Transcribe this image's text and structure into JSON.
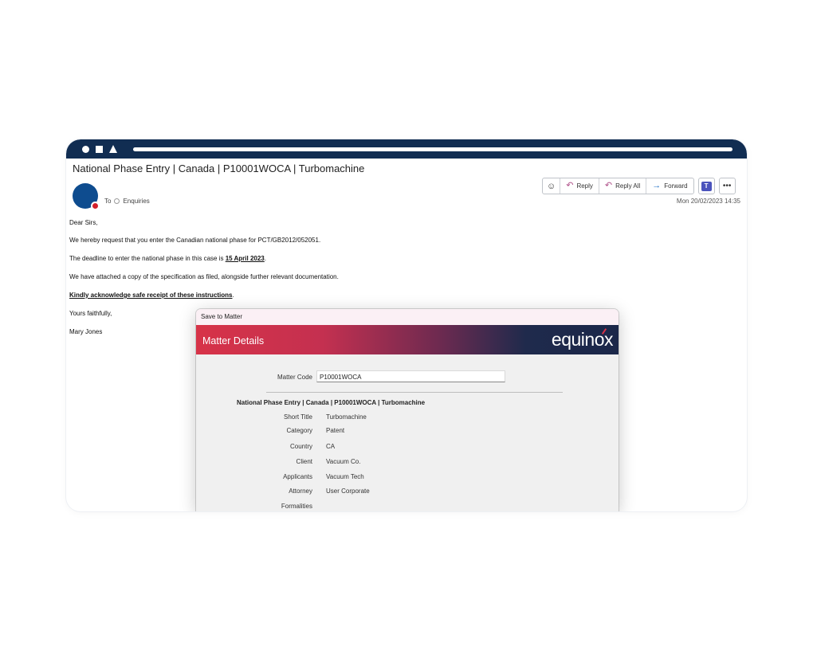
{
  "window": {
    "subject": "National Phase Entry | Canada | P10001WOCA | Turbomachine"
  },
  "header": {
    "to_label": "To",
    "recipient": "Enquiries",
    "timestamp": "Mon 20/02/2023 14:35"
  },
  "toolbar": {
    "reply_label": "Reply",
    "reply_all_label": "Reply All",
    "forward_label": "Forward",
    "teams_label": "T",
    "more_label": "•••"
  },
  "body": {
    "greeting": "Dear Sirs,",
    "p1": "We hereby request that you enter the Canadian national phase for PCT/GB2012/052051.",
    "p2_prefix": "The deadline to enter the national phase in this case is ",
    "p2_date": "15 April 2023",
    "p2_suffix": ".",
    "p3": "We have attached a copy of the specification as filed, alongside further relevant documentation.",
    "p4_bold": "Kindly acknowledge safe receipt of these instructions",
    "p4_suffix": ".",
    "closing": "Yours faithfully,",
    "signature": "Mary Jones"
  },
  "dialog": {
    "title": "Save to Matter",
    "heading": "Matter Details",
    "logo": "equinox",
    "matter_code_label": "Matter Code",
    "matter_code_value": "P10001WOCA",
    "matter_subject": "National Phase Entry | Canada | P10001WOCA | Turbomachine",
    "fields": [
      {
        "label": "Short Title",
        "value": "Turbomachine"
      },
      {
        "label": "Category",
        "value": "Patent"
      },
      {
        "label": "Country",
        "value": "CA"
      },
      {
        "label": "Client",
        "value": "Vacuum Co."
      },
      {
        "label": "Applicants",
        "value": "Vacuum Tech"
      },
      {
        "label": "Attorney",
        "value": "User Corporate"
      },
      {
        "label": "Formalities",
        "value": ""
      }
    ]
  },
  "colors": {
    "titlebar": "#112d52",
    "avatar": "#0e4c8f",
    "presence": "#d21f2b",
    "header_gradient_start": "#d73348",
    "header_gradient_end": "#1b2749"
  }
}
